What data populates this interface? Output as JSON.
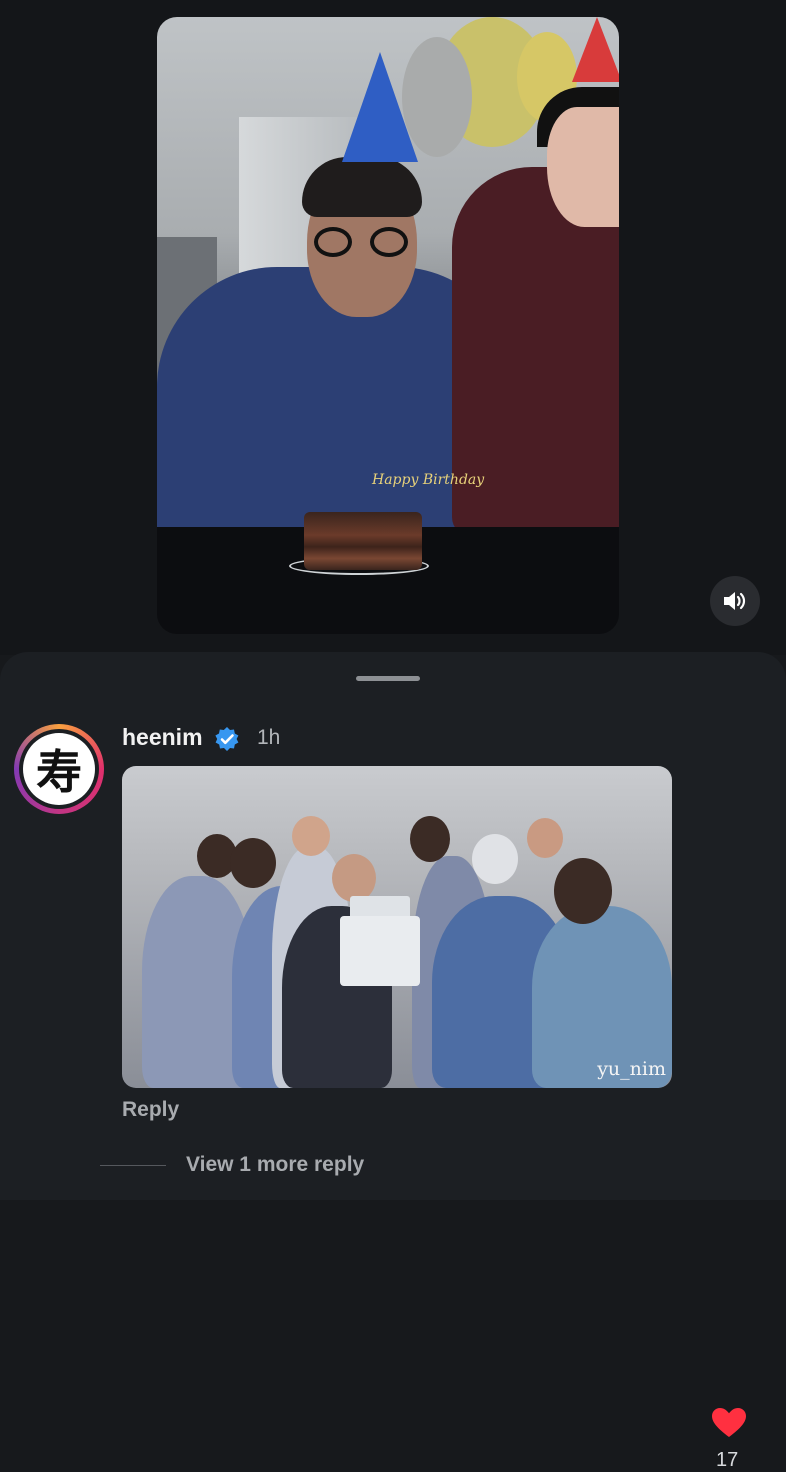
{
  "video": {
    "topper_text": "Happy Birthday",
    "sound_icon": "speaker-icon"
  },
  "comment": {
    "username": "heenim",
    "verified_icon": "verified-badge-icon",
    "time": "1h",
    "avatar_glyph": "寿",
    "gif_watermark": "yu_nim",
    "like_icon": "heart-icon",
    "like_count": "17",
    "like_color": "#ff3040",
    "reply_label": "Reply",
    "more_replies_label": "View 1 more reply"
  },
  "colors": {
    "background": "#17191c",
    "sheet": "#1c1f23",
    "verified": "#3797f0"
  }
}
